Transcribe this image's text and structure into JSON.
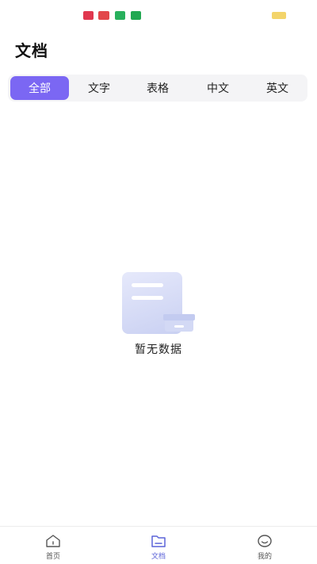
{
  "page": {
    "title": "文档"
  },
  "tabs": [
    {
      "label": "全部",
      "active": true
    },
    {
      "label": "文字",
      "active": false
    },
    {
      "label": "表格",
      "active": false
    },
    {
      "label": "中文",
      "active": false
    },
    {
      "label": "英文",
      "active": false
    }
  ],
  "empty_state": {
    "message": "暂无数据",
    "icon": "empty-document-icon"
  },
  "bottom_nav": {
    "items": [
      {
        "label": "首页",
        "icon": "home-icon",
        "active": false
      },
      {
        "label": "文档",
        "icon": "folder-icon",
        "active": true
      },
      {
        "label": "我的",
        "icon": "smile-icon",
        "active": false
      }
    ]
  },
  "colors": {
    "accent": "#7b67f3",
    "nav_active": "#5b63d8",
    "tab_bar_bg": "#f4f4f6"
  }
}
